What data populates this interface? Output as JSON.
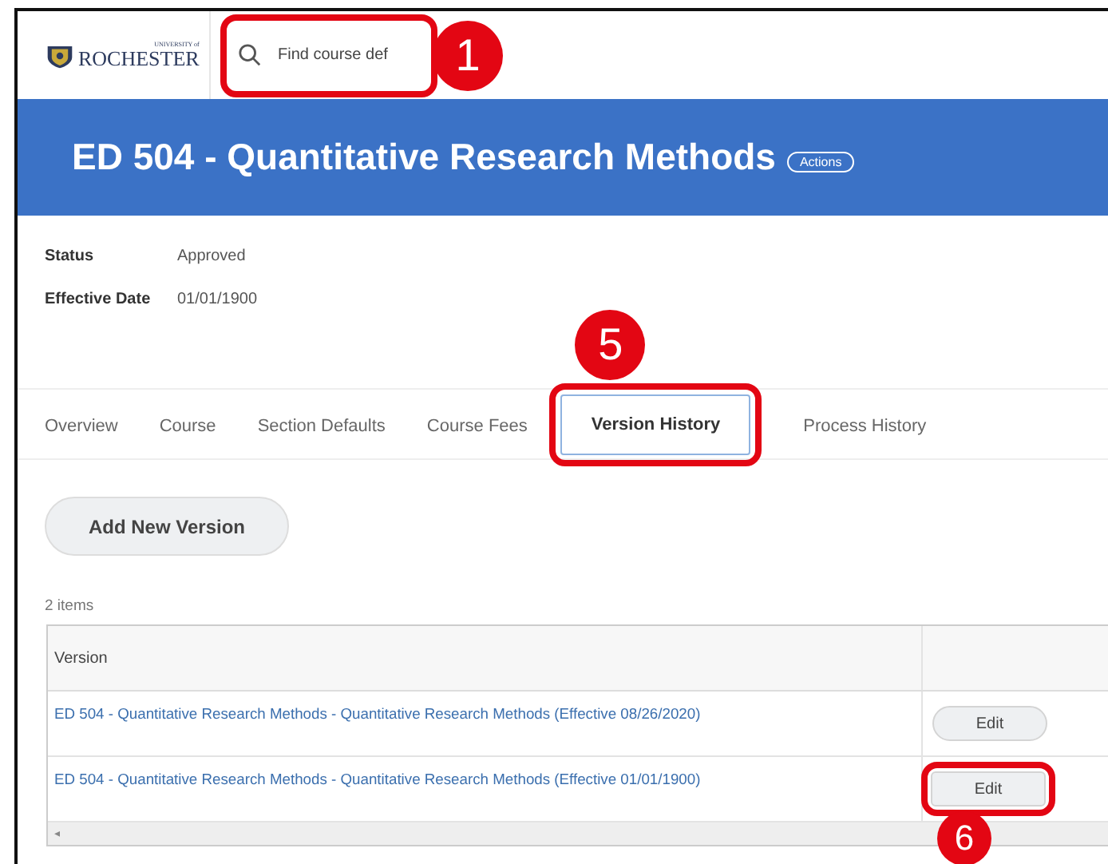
{
  "header": {
    "logo": {
      "small_text": "UNIVERSITY of",
      "name": "ROCHESTER"
    },
    "search": {
      "placeholder": "Find course def",
      "callout": "1"
    }
  },
  "banner": {
    "title": "ED 504 - Quantitative Research Methods",
    "actions": "Actions"
  },
  "fields": [
    {
      "label": "Status",
      "value": "Approved"
    },
    {
      "label": "Effective Date",
      "value": "01/01/1900"
    }
  ],
  "tabs": [
    {
      "label": "Overview",
      "selected": false
    },
    {
      "label": "Course",
      "selected": false
    },
    {
      "label": "Section Defaults",
      "selected": false
    },
    {
      "label": "Course Fees",
      "selected": false
    },
    {
      "label": "Version History",
      "selected": true,
      "callout": "5"
    },
    {
      "label": "Process History",
      "selected": false
    }
  ],
  "add_button": "Add New Version",
  "item_count": "2 items",
  "table": {
    "columns": [
      "Version"
    ],
    "rows": [
      {
        "version": "ED 504 - Quantitative Research Methods - Quantitative Research Methods (Effective 08/26/2020)",
        "action": "Edit"
      },
      {
        "version": "ED 504 - Quantitative Research Methods - Quantitative Research Methods (Effective 01/01/1900)",
        "action": "Edit",
        "callout": "6"
      }
    ],
    "scroll_arrow": "◂"
  }
}
